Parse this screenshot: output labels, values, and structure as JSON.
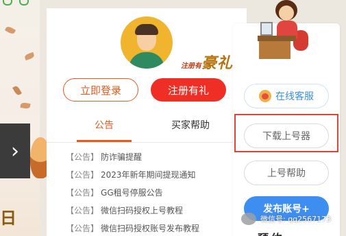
{
  "left_banner": {
    "carousel_arrow": "›",
    "partial_word": "日"
  },
  "panel": {
    "promo_small": "注册有",
    "promo_big": "豪礼",
    "login_label": "立即登录",
    "register_label": "注册有礼",
    "tabs": [
      {
        "label": "公告",
        "active": true
      },
      {
        "label": "买家帮助",
        "active": false
      }
    ],
    "notices": [
      {
        "tag": "【公告】",
        "title": "防诈骗提醒"
      },
      {
        "tag": "【公告】",
        "title": "2023年新年期间提现通知"
      },
      {
        "tag": "【公告】",
        "title": "GG租号停服公告"
      },
      {
        "tag": "【公告】",
        "title": "微信扫码授权上号教程"
      },
      {
        "tag": "【公告】",
        "title": "微信扫码授权账号发布教程"
      }
    ]
  },
  "sidebar": {
    "online_service": "在线客服",
    "download_tool": "下载上号器",
    "login_help": "上号帮助",
    "publish_account": "发布账号+",
    "cut_text": "预约"
  },
  "watermark": {
    "text": "微信号: qq2567173"
  },
  "colors": {
    "accent_orange": "#e85a1e",
    "register_red": "#ef2f25",
    "publish_blue": "#3d8ef0",
    "highlight_red": "#e0423a"
  }
}
